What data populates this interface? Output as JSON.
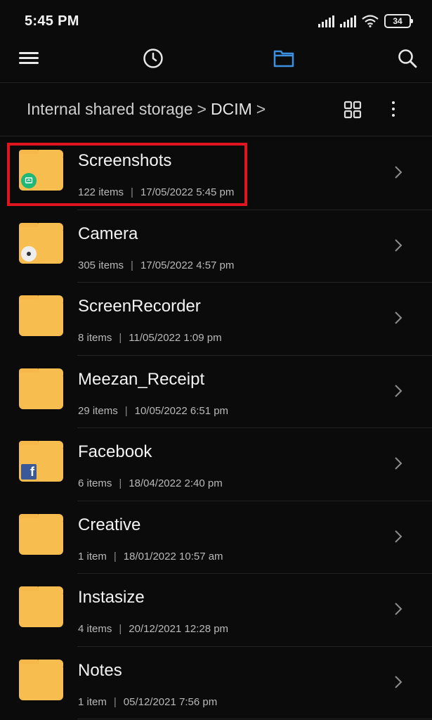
{
  "status_bar": {
    "time": "5:45 PM",
    "battery": "34"
  },
  "toolbar": {
    "menu_icon": "hamburger-menu-icon",
    "recent_icon": "clock-icon",
    "files_icon": "folder-icon",
    "search_icon": "search-icon",
    "active_color": "#3d8fe0"
  },
  "breadcrumb": {
    "root": "Internal shared storage",
    "separator": ">",
    "current": "DCIM"
  },
  "colors": {
    "folder": "#f8bd4f",
    "highlight": "#e01520",
    "background": "#0b0b0b"
  },
  "folders": [
    {
      "name": "Screenshots",
      "count": "122 items",
      "date": "17/05/2022 5:45 pm",
      "badge": "screenshot-badge-icon"
    },
    {
      "name": "Camera",
      "count": "305 items",
      "date": "17/05/2022 4:57 pm",
      "badge": "camera-badge-icon"
    },
    {
      "name": "ScreenRecorder",
      "count": "8 items",
      "date": "11/05/2022 1:09 pm"
    },
    {
      "name": "Meezan_Receipt",
      "count": "29 items",
      "date": "10/05/2022 6:51 pm"
    },
    {
      "name": "Facebook",
      "count": "6 items",
      "date": "18/04/2022 2:40 pm",
      "badge": "facebook-badge-icon"
    },
    {
      "name": "Creative",
      "count": "1 item",
      "date": "18/01/2022 10:57 am"
    },
    {
      "name": "Instasize",
      "count": "4 items",
      "date": "20/12/2021 12:28 pm"
    },
    {
      "name": "Notes",
      "count": "1 item",
      "date": "05/12/2021 7:56 pm"
    }
  ]
}
